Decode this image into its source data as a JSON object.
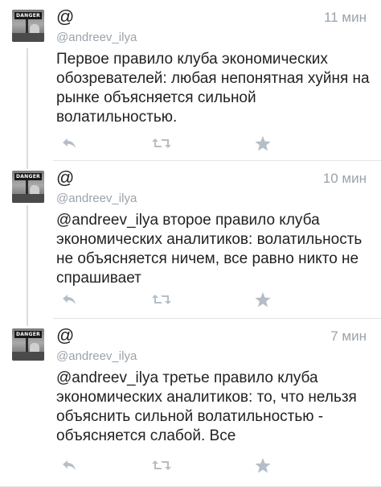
{
  "tweets": [
    {
      "name": "@",
      "handle": "@andreev_ilya",
      "time": "11 мин",
      "avatar_label": "DANGER",
      "text": "Первое правило клуба экономических обозревателей: любая непонятная хуйня на рынке объясняется сильной волатильностью."
    },
    {
      "name": "@",
      "handle": "@andreev_ilya",
      "time": "10 мин",
      "avatar_label": "DANGER",
      "text": "@andreev_ilya второе правило клуба экономических аналитиков: волатильность не объясняется ничем, все равно никто не спрашивает"
    },
    {
      "name": "@",
      "handle": "@andreev_ilya",
      "time": "7 мин",
      "avatar_label": "DANGER",
      "text": "@andreev_ilya третье правило клуба экономических аналитиков: то, что нельзя объяснить сильной волатильностью - объясняется слабой. Все"
    }
  ],
  "icons": {
    "reply": "reply-icon",
    "retweet": "retweet-icon",
    "favorite": "star-icon"
  },
  "colors": {
    "text": "#222222",
    "muted": "#9aa3ab",
    "icon": "#b5bec6",
    "thread_line": "#d6dde3",
    "divider": "#e3e3e3"
  }
}
